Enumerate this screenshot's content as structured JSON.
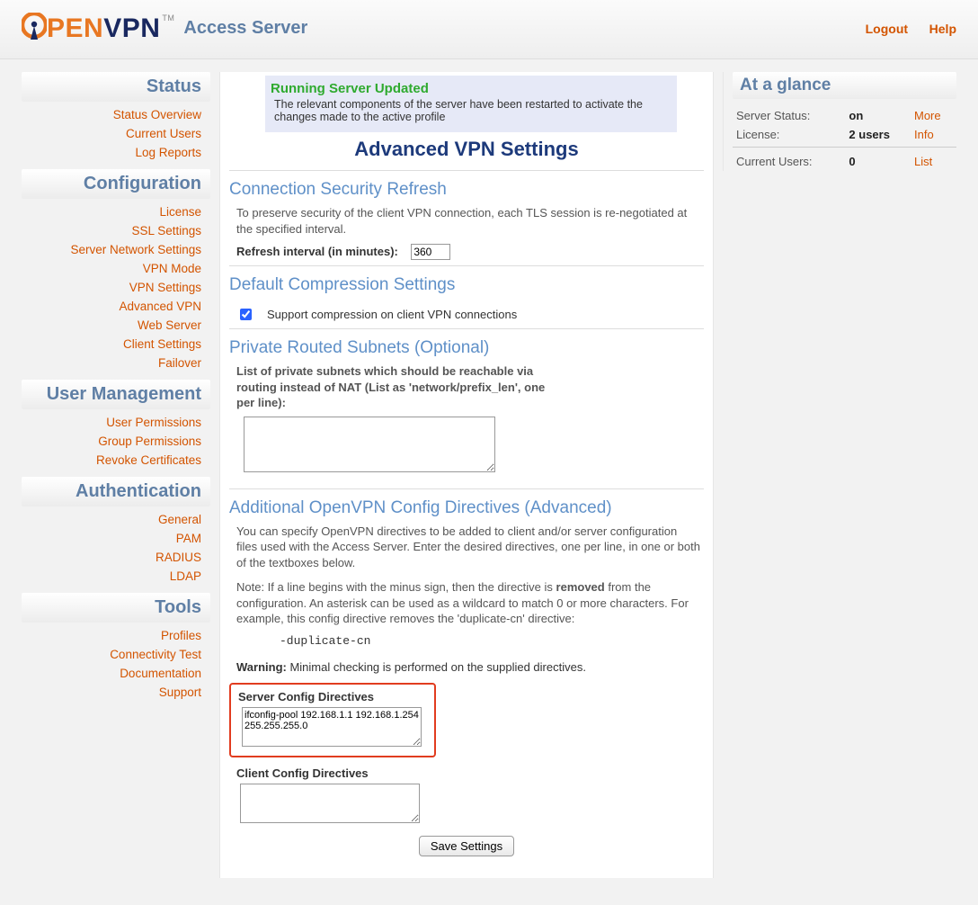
{
  "app": {
    "brand_pen": "PEN",
    "brand_vpn": "VPN",
    "brand_tm": "TM",
    "subtitle": "Access Server"
  },
  "toplinks": {
    "logout": "Logout",
    "help": "Help"
  },
  "nav": {
    "status": {
      "head": "Status",
      "items": [
        "Status Overview",
        "Current Users",
        "Log Reports"
      ]
    },
    "config": {
      "head": "Configuration",
      "items": [
        "License",
        "SSL Settings",
        "Server Network Settings",
        "VPN Mode",
        "VPN Settings",
        "Advanced VPN",
        "Web Server",
        "Client Settings",
        "Failover"
      ]
    },
    "usermgmt": {
      "head": "User Management",
      "items": [
        "User Permissions",
        "Group Permissions",
        "Revoke Certificates"
      ]
    },
    "auth": {
      "head": "Authentication",
      "items": [
        "General",
        "PAM",
        "RADIUS",
        "LDAP"
      ]
    },
    "tools": {
      "head": "Tools",
      "items": [
        "Profiles",
        "Connectivity Test",
        "Documentation",
        "Support"
      ]
    }
  },
  "alert": {
    "title": "Running Server Updated",
    "body": "The relevant components of the server have been restarted to activate the changes made to the active profile"
  },
  "page": {
    "title": "Advanced VPN Settings"
  },
  "sec_refresh": {
    "head": "Connection Security Refresh",
    "desc": "To preserve security of the client VPN connection, each TLS session is re-negotiated at the specified interval.",
    "label": "Refresh interval (in minutes):",
    "value": "360"
  },
  "sec_comp": {
    "head": "Default Compression Settings",
    "checkbox_label": "Support compression on client VPN connections",
    "checked": true
  },
  "sec_subnets": {
    "head": "Private Routed Subnets (Optional)",
    "label": "List of private subnets which should be reachable via routing instead of NAT (List as 'network/prefix_len', one per line):",
    "value": ""
  },
  "sec_directives": {
    "head": "Additional OpenVPN Config Directives (Advanced)",
    "desc1": "You can specify OpenVPN directives to be added to client and/or server configuration files used with the Access Server. Enter the desired directives, one per line, in one or both of the textboxes below.",
    "desc2a": "Note: If a line begins with the minus sign, then the directive is ",
    "desc2b": "removed",
    "desc2c": " from the configuration. An asterisk can be used as a wildcard to match 0 or more characters. For example, this config directive removes the 'duplicate-cn' directive:",
    "example": "-duplicate-cn",
    "warn_label": "Warning:",
    "warn_text": " Minimal checking is performed on the supplied directives.",
    "server_label": "Server Config Directives",
    "server_value": "ifconfig-pool 192.168.1.1 192.168.1.254 255.255.255.0",
    "client_label": "Client Config Directives",
    "client_value": ""
  },
  "save": {
    "label": "Save Settings"
  },
  "glance": {
    "head": "At a glance",
    "rows": {
      "status_label": "Server Status:",
      "status_value": "on",
      "status_link": "More",
      "lic_label": "License:",
      "lic_value": "2 users",
      "lic_link": "Info",
      "users_label": "Current Users:",
      "users_value": "0",
      "users_link": "List"
    }
  }
}
